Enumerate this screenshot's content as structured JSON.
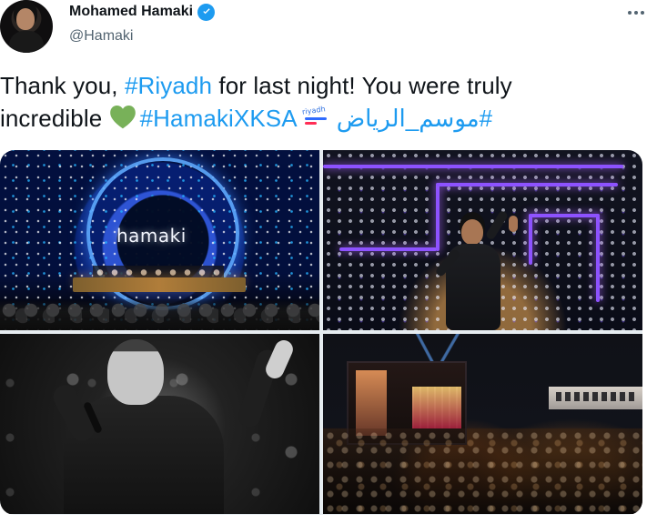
{
  "tweet": {
    "author": {
      "display_name": "Mohamed Hamaki",
      "handle": "@Hamaki"
    },
    "text": {
      "line1_prefix": "Thank you, ",
      "line1_hashtag": "#Riyadh",
      "line1_suffix": " for last night! You were truly",
      "line2_prefix": "incredible ",
      "line2_hashtag": "#HamakiXKSA",
      "line2_arabic_hashtag": "#موسم_الرياض"
    },
    "emoji": {
      "heart": "green-heart",
      "logo_badge": "riyadh-season-badge"
    },
    "media": {
      "photo1_title": "hamaki"
    }
  },
  "colors": {
    "link": "#1d9bf0",
    "text": "#0f1419",
    "secondary": "#536471",
    "verified": "#1d9bf0",
    "heart": "#78b159"
  }
}
